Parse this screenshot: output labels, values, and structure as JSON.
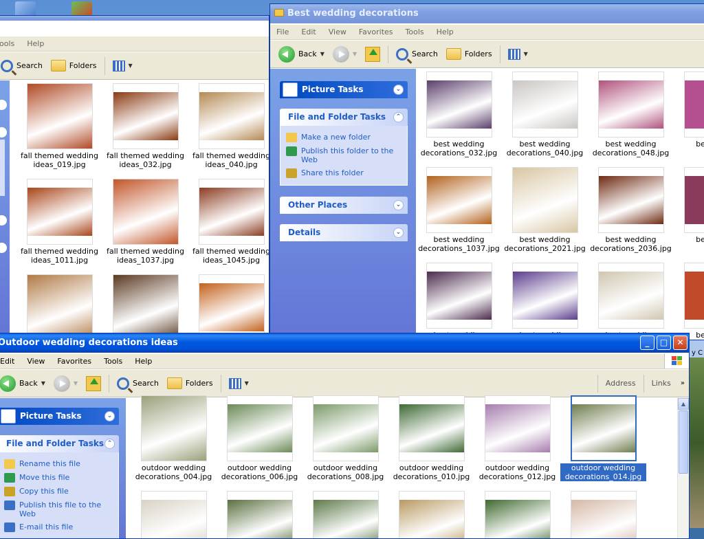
{
  "colors": {
    "title_active": "#0058e0",
    "title_inactive": "#7f9fe0",
    "taskpane": "#6375d6",
    "selection": "#316ac5"
  },
  "win_left": {
    "menu": [
      "ools",
      "Help"
    ],
    "toolbar": {
      "search": "Search",
      "folders": "Folders"
    },
    "thumbs": [
      {
        "cap": "fall themed wedding ideas_019.jpg",
        "color": "#b04a25",
        "tall": true
      },
      {
        "cap": "fall themed wedding ideas_032.jpg",
        "color": "#8a3a12"
      },
      {
        "cap": "fall themed wedding ideas_040.jpg",
        "color": "#b58a55"
      },
      {
        "cap": "fall themed wedding ideas_1011.jpg",
        "color": "#a8461a"
      },
      {
        "cap": "fall themed wedding ideas_1037.jpg",
        "color": "#c2562a",
        "tall": true
      },
      {
        "cap": "fall themed wedding ideas_1045.jpg",
        "color": "#8c3d22"
      },
      {
        "cap": "",
        "color": "#b07a46",
        "tall": true
      },
      {
        "cap": "",
        "color": "#5a3a22",
        "tall": true
      },
      {
        "cap": "",
        "color": "#c2621d"
      }
    ]
  },
  "win_right": {
    "title": "Best wedding decorations",
    "menu": [
      "File",
      "Edit",
      "View",
      "Favorites",
      "Tools",
      "Help"
    ],
    "toolbar": {
      "back": "Back",
      "search": "Search",
      "folders": "Folders"
    },
    "task_pane": {
      "picture_tasks": "Picture Tasks",
      "file_folder_tasks": "File and Folder Tasks",
      "links": [
        "Make a new folder",
        "Publish this folder to the Web",
        "Share this folder"
      ],
      "other_places": "Other Places",
      "details": "Details"
    },
    "thumbs": [
      {
        "cap": "best wedding decorations_032.jpg",
        "color": "#5a3f6b"
      },
      {
        "cap": "best wedding decorations_040.jpg",
        "color": "#c9c5c2"
      },
      {
        "cap": "best wedding decorations_048.jpg",
        "color": "#b0527d"
      },
      {
        "cap": "best wedding decorations_1037.jpg",
        "color": "#b2621c"
      },
      {
        "cap": "best wedding decorations_2021.jpg",
        "color": "#d8c6a3",
        "tall": true
      },
      {
        "cap": "best wedding decorations_2036.jpg",
        "color": "#6e2a12"
      },
      {
        "cap": "best wedding",
        "color": "#4b2a4d"
      },
      {
        "cap": "best wedding",
        "color": "#5b3d8c"
      },
      {
        "cap": "best wedding",
        "color": "#d0c6b0"
      }
    ],
    "partial_caps": [
      "bes decora",
      "bes decora",
      "bes decora"
    ]
  },
  "win_bottom": {
    "title": "Outdoor wedding decorations ideas",
    "menu": [
      "Edit",
      "View",
      "Favorites",
      "Tools",
      "Help"
    ],
    "toolbar": {
      "back": "Back",
      "search": "Search",
      "folders": "Folders",
      "address": "Address",
      "links": "Links"
    },
    "task_pane": {
      "picture_tasks": "Picture Tasks",
      "file_folder_tasks": "File and Folder Tasks",
      "links": [
        "Rename this file",
        "Move this file",
        "Copy this file",
        "Publish this file to the Web",
        "E-mail this file"
      ]
    },
    "thumbs": [
      {
        "cap": "outdoor wedding decorations_004.jpg",
        "color": "#9aa07a",
        "tall": true
      },
      {
        "cap": "outdoor wedding decorations_006.jpg",
        "color": "#6b8a58"
      },
      {
        "cap": "outdoor wedding decorations_008.jpg",
        "color": "#7b9a6a"
      },
      {
        "cap": "outdoor wedding decorations_010.jpg",
        "color": "#3f6a35"
      },
      {
        "cap": "outdoor wedding decorations_012.jpg",
        "color": "#a77dae"
      },
      {
        "cap": "outdoor wedding decorations_014.jpg",
        "color": "#6f7d4f",
        "selected": true
      },
      {
        "cap": "",
        "color": "#d9d2c4"
      },
      {
        "cap": "",
        "color": "#5b7040"
      },
      {
        "cap": "",
        "color": "#5e7a4a"
      },
      {
        "cap": "",
        "color": "#b89a62"
      },
      {
        "cap": "",
        "color": "#3f6a2f"
      },
      {
        "cap": "",
        "color": "#d4b8a6"
      }
    ],
    "side_text": "y C"
  }
}
